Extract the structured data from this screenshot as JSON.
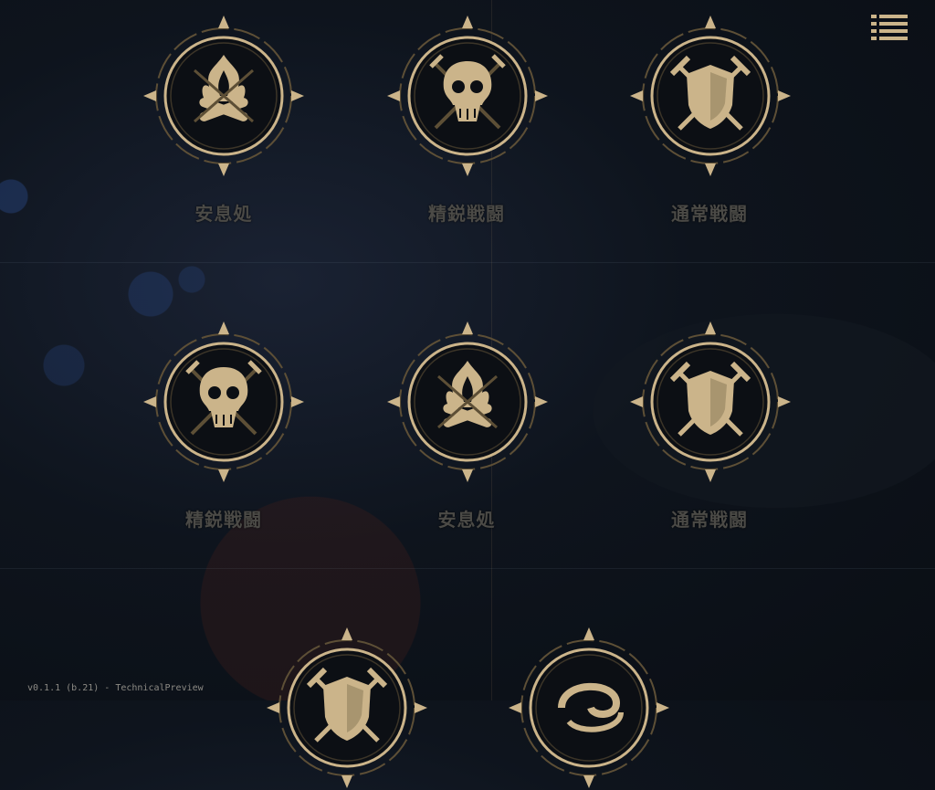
{
  "menu": {
    "icon": "hamburger-menu-icon"
  },
  "version_text": "v0.1.1 (b.21) - TechnicalPreview",
  "nodes": [
    {
      "label": "安息処",
      "icon": "campfire-icon"
    },
    {
      "label": "精鋭戦闘",
      "icon": "skull-crossed-swords-icon"
    },
    {
      "label": "通常戦闘",
      "icon": "shield-crossed-swords-icon"
    },
    {
      "label": "精鋭戦闘",
      "icon": "skull-crossed-swords-icon"
    },
    {
      "label": "安息処",
      "icon": "campfire-icon"
    },
    {
      "label": "通常戦闘",
      "icon": "shield-crossed-swords-icon"
    },
    {
      "label": "",
      "icon": "shield-crossed-swords-icon"
    },
    {
      "label": "",
      "icon": "swirl-storm-icon"
    }
  ],
  "colors": {
    "gold": "#cbb48a",
    "dark_gold": "#5d4f36",
    "label_gray": "#4b4a46"
  }
}
